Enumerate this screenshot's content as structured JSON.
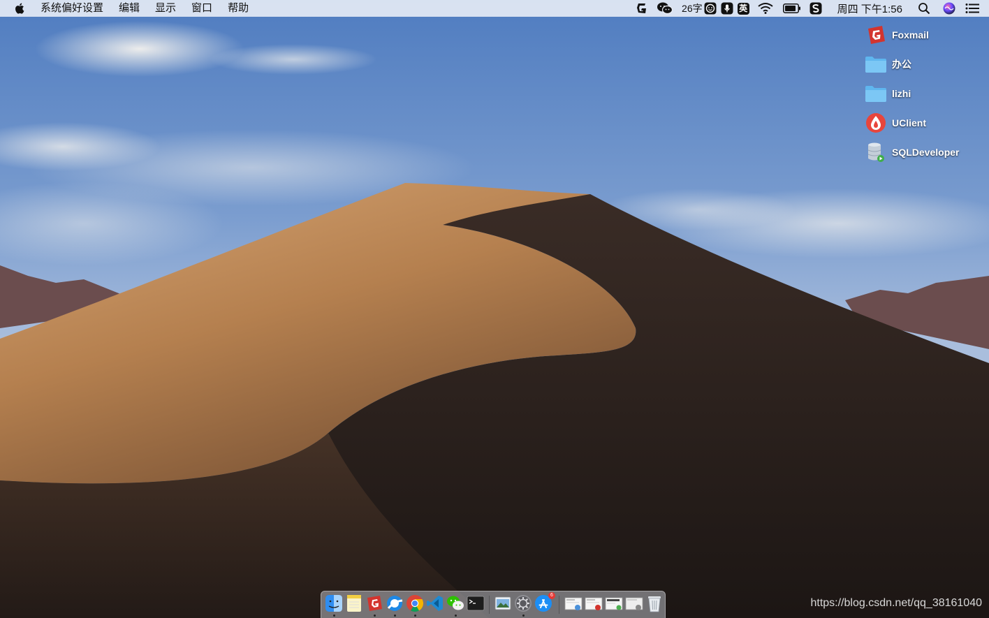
{
  "menubar": {
    "app_name": "系统偏好设置",
    "menus": [
      "编辑",
      "显示",
      "窗口",
      "帮助"
    ],
    "word_count": "26字",
    "ime_label": "英",
    "clock": "周四 下午1:56",
    "status_icons": [
      "foxmail-icon",
      "wechat-icon",
      "face-icon",
      "mic-icon",
      "ime-icon",
      "wifi-icon",
      "battery-icon",
      "sogou-icon",
      "search-icon",
      "siri-icon",
      "list-icon"
    ]
  },
  "desktop": {
    "icons": [
      {
        "label": "Foxmail",
        "icon": "foxmail-icon"
      },
      {
        "label": "办公",
        "icon": "folder-icon"
      },
      {
        "label": "lizhi",
        "icon": "folder-icon"
      },
      {
        "label": "UClient",
        "icon": "uclient-icon"
      },
      {
        "label": "SQLDeveloper",
        "icon": "database-icon"
      }
    ]
  },
  "dock": {
    "apps": [
      "finder",
      "notes",
      "foxmail",
      "qq-browser",
      "chrome",
      "vscode",
      "wechat",
      "terminal",
      "preview",
      "system-preferences",
      "app-store",
      "document",
      "document-mail",
      "document-screen",
      "document-settings",
      "trash"
    ],
    "app_store_badge": "6"
  },
  "watermark": "https://blog.csdn.net/qq_38161040",
  "colors": {
    "sky_top": "#5a84c4",
    "sand_light": "#c89a66",
    "sand_shadow": "#2a211e",
    "foxmail_red": "#d3342e"
  }
}
